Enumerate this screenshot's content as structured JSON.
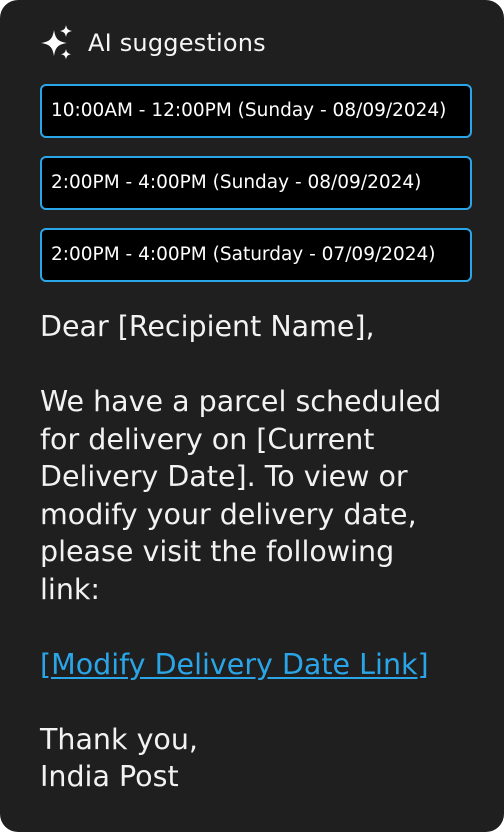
{
  "header": {
    "icon": "sparkle-icon",
    "title": "AI suggestions"
  },
  "suggestions": [
    "10:00AM - 12:00PM (Sunday - 08/09/2024)",
    "2:00PM - 4:00PM (Sunday - 08/09/2024)",
    "2:00PM - 4:00PM (Saturday - 07/09/2024)"
  ],
  "message": {
    "greeting": "Dear [Recipient Name],",
    "body_lines": [
      "We have a parcel scheduled",
      "for delivery on [Current",
      "Delivery Date]. To view or",
      "modify your delivery date,",
      "please visit the following",
      "link:"
    ],
    "link_text": "[Modify Delivery Date Link]",
    "closing": "Thank you,",
    "signature": "India Post"
  },
  "colors": {
    "background": "#1f1f1f",
    "accent": "#2aa6e8",
    "text": "#f2f2f2",
    "suggestion_bg": "#000000"
  }
}
